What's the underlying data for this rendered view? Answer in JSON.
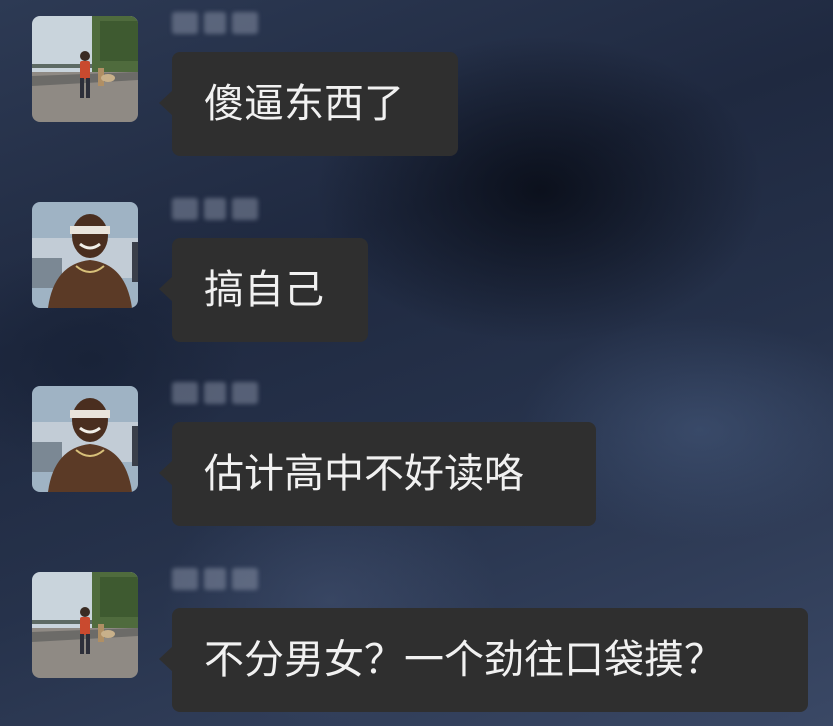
{
  "messages": [
    {
      "avatar": "walking-person-avatar",
      "sender_name": "",
      "text": "傻逼东西了"
    },
    {
      "avatar": "smiling-man-avatar",
      "sender_name": "",
      "text": "搞自己"
    },
    {
      "avatar": "smiling-man-avatar",
      "sender_name": "",
      "text": "估计高中不好读咯"
    },
    {
      "avatar": "walking-person-avatar",
      "sender_name": "",
      "text": "不分男女？一个劲往口袋摸？"
    }
  ],
  "colors": {
    "bubble": "#2f2f2f",
    "bubble_text": "#f1f1f1",
    "background": "#26324b"
  }
}
